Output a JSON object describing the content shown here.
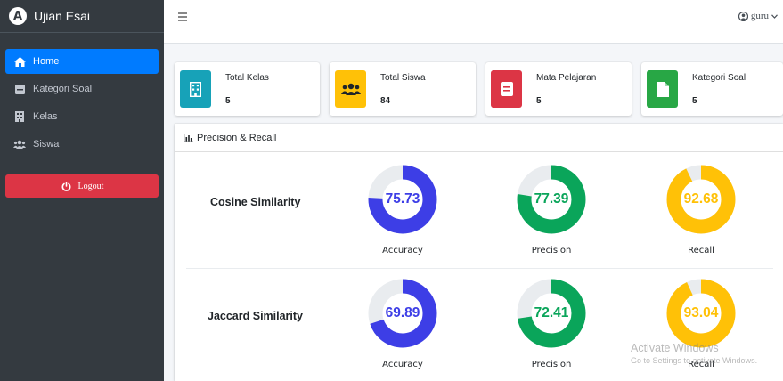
{
  "app": {
    "brand": "Ujian Esai"
  },
  "sidebar": {
    "items": [
      {
        "label": "Home",
        "icon": "home-icon",
        "active": true
      },
      {
        "label": "Kategori Soal",
        "icon": "folder-icon"
      },
      {
        "label": "Kelas",
        "icon": "building-icon"
      },
      {
        "label": "Siswa",
        "icon": "users-icon"
      }
    ],
    "logout_label": "Logout"
  },
  "header": {
    "user_label": "guru"
  },
  "stats": [
    {
      "label": "Total Kelas",
      "value": "5",
      "color": "#17a2b8",
      "icon": "building-icon"
    },
    {
      "label": "Total Siswa",
      "value": "84",
      "color": "#ffc107",
      "icon": "users-icon"
    },
    {
      "label": "Mata Pelajaran",
      "value": "5",
      "color": "#dc3545",
      "icon": "book-icon"
    },
    {
      "label": "Kategori Soal",
      "value": "5",
      "color": "#28a745",
      "icon": "file-icon"
    }
  ],
  "card": {
    "title": "Precision & Recall",
    "rows": [
      {
        "label": "Cosine Similarity",
        "metrics": [
          {
            "label": "Accuracy",
            "value": "75.73",
            "color": "#3d3ee6"
          },
          {
            "label": "Precision",
            "value": "77.39",
            "color": "#0aa55a"
          },
          {
            "label": "Recall",
            "value": "92.68",
            "color": "#ffc107"
          }
        ]
      },
      {
        "label": "Jaccard Similarity",
        "metrics": [
          {
            "label": "Accuracy",
            "value": "69.89",
            "color": "#3d3ee6"
          },
          {
            "label": "Precision",
            "value": "72.41",
            "color": "#0aa55a"
          },
          {
            "label": "Recall",
            "value": "93.04",
            "color": "#ffc107"
          }
        ]
      }
    ]
  },
  "watermark": {
    "line1": "Activate Windows",
    "line2": "Go to Settings to activate Windows."
  },
  "colors": {
    "sidebar": "#343a40",
    "primary": "#007bff",
    "danger": "#dc3545",
    "track": "#e9ecef"
  }
}
